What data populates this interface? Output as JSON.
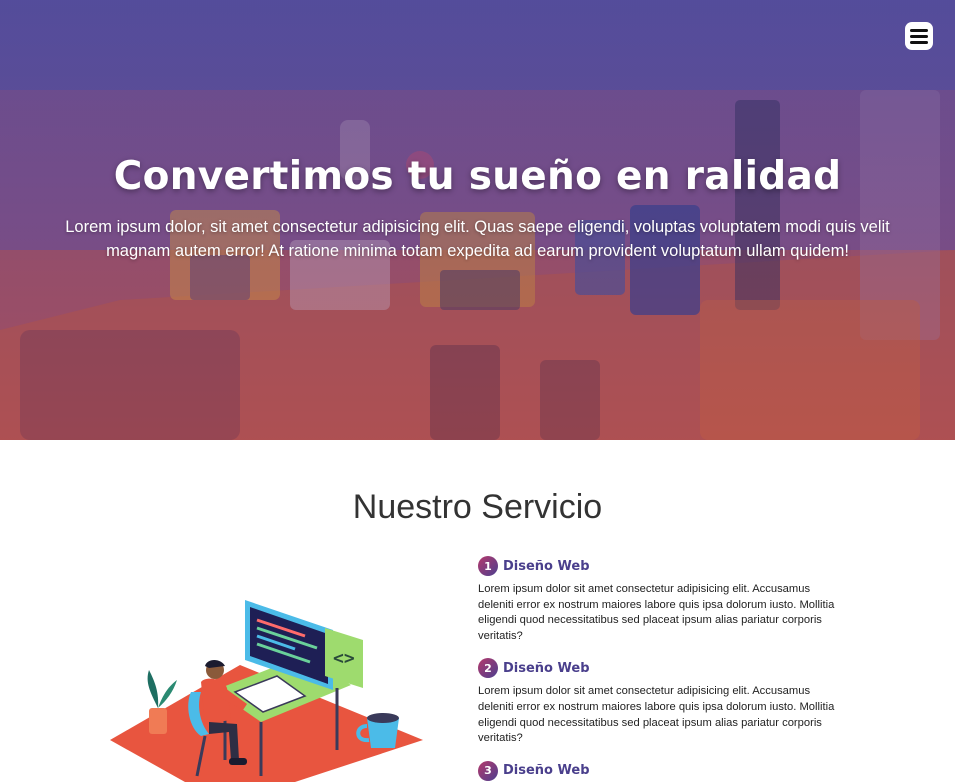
{
  "header": {
    "menu_icon": "hamburger-menu-icon"
  },
  "hero": {
    "title": "Convertimos tu sueño en ralidad",
    "text": "Lorem ipsum dolor, sit amet consectetur adipisicing elit. Quas saepe eligendi, voluptas voluptatem modi quis velit magnam autem error! At ratione minima totam expedita ad earum provident voluptatum ullam quidem!",
    "overlay_colors": [
      "#4f4f9a",
      "#8a4f78",
      "#b4564f"
    ]
  },
  "services": {
    "title": "Nuestro Servicio",
    "items": [
      {
        "number": "1",
        "name": "Diseño Web",
        "description": "Lorem ipsum dolor sit amet consectetur adipisicing elit. Accusamus deleniti error ex nostrum maiores labore quis ipsa dolorum iusto. Mollitia eligendi quod necessitatibus sed placeat ipsum alias pariatur corporis veritatis?"
      },
      {
        "number": "2",
        "name": "Diseño Web",
        "description": "Lorem ipsum dolor sit amet consectetur adipisicing elit. Accusamus deleniti error ex nostrum maiores labore quis ipsa dolorum iusto. Mollitia eligendi quod necessitatibus sed placeat ipsum alias pariatur corporis veritatis?"
      },
      {
        "number": "3",
        "name": "Diseño Web",
        "description": ""
      }
    ]
  },
  "colors": {
    "accent": "#4a3f8c",
    "badge_gradient": [
      "#b5396b",
      "#4c3f8f"
    ]
  }
}
